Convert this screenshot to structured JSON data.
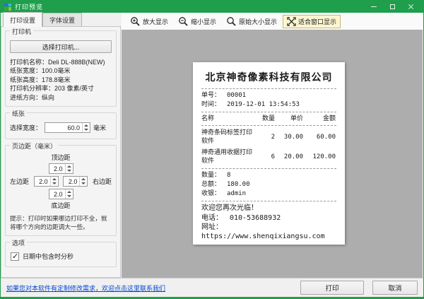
{
  "window": {
    "title": "打印预览"
  },
  "tabs": {
    "print_settings": "打印设置",
    "font_settings": "字体设置"
  },
  "toolbar": {
    "zoom_in": "放大显示",
    "zoom_out": "缩小显示",
    "original_size": "原始大小显示",
    "fit_window": "适合窗口显示"
  },
  "printer": {
    "group_label": "打印机",
    "select_button": "选择打印机...",
    "info": [
      "打印机名称：Deli DL-888B(NEW)",
      "纸张宽度：100.0毫米",
      "纸张高度：178.8毫米",
      "打印机分辨率：203 像素/英寸",
      "进纸方向：纵向"
    ]
  },
  "paper": {
    "group_label": "纸张",
    "width_label": "选择宽度：",
    "width_value": "60.0",
    "unit": "毫米"
  },
  "margins": {
    "group_label": "页边距（毫米）",
    "top_label": "顶边距",
    "bottom_label": "底边距",
    "left_label": "左边距",
    "right_label": "右边距",
    "top_value": "2.0",
    "bottom_value": "2.0",
    "left_value": "2.0",
    "right_value": "2.0",
    "hint": "提示：打印时如果哪边打印不全，就将哪个方向的边距调大一些。"
  },
  "options": {
    "group_label": "选项",
    "include_time_label": "日期中包含时分秒",
    "checked": true
  },
  "receipt": {
    "company": "北京神奇像素科技有限公司",
    "order_label": "单号：",
    "order_no": "00001",
    "time_label": "时间：",
    "time": "2019-12-01 13:54:53",
    "columns": {
      "name": "名称",
      "qty": "数量",
      "price": "单价",
      "amount": "金额"
    },
    "items": [
      {
        "name": "神奇条码标签打印软件",
        "qty": "2",
        "price": "30.00",
        "amount": "60.00"
      },
      {
        "name": "神奇通用收据打印软件",
        "qty": "6",
        "price": "20.00",
        "amount": "120.00"
      }
    ],
    "totals": {
      "qty_label": "数量：",
      "qty": "8",
      "sum_label": "总额：",
      "sum": "180.00",
      "cashier_label": "收银：",
      "cashier": "admin"
    },
    "footer": {
      "welcome": "欢迎您再次光临！",
      "phone_label": "电话：",
      "phone": "010-53688932",
      "site_label": "网址：",
      "url": "https://www.shenqixiangsu.com"
    }
  },
  "statusbar": {
    "link": "如果您对本软件有定制修改需求，欢迎点击这里联系我们"
  },
  "actions": {
    "print": "打印",
    "cancel": "取消"
  },
  "colors": {
    "titlebar_green": "#1f9e4c",
    "preview_bg": "#adadad",
    "toolbar_highlight": "#fdf5d0",
    "link_blue": "#0046d5"
  }
}
